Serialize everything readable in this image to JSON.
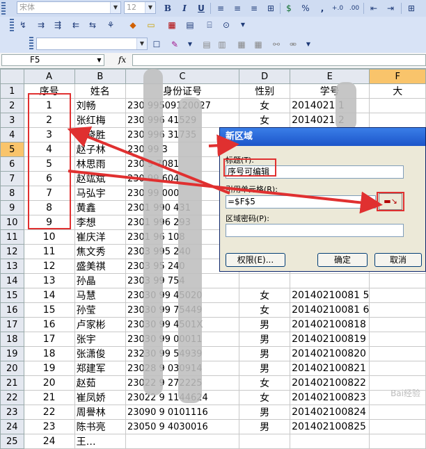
{
  "toolbar": {
    "font_name": "宋体",
    "font_size": "12",
    "bold": "B",
    "italic": "I",
    "underline": "U",
    "percent": "%",
    "comma": ","
  },
  "formula_bar": {
    "cell_ref": "F5",
    "fx": "fx"
  },
  "columns": [
    "A",
    "B",
    "C",
    "D",
    "E",
    "F"
  ],
  "headers": {
    "seq": "序号",
    "name": "姓名",
    "id": "身份证号",
    "gender": "性别",
    "student_id": "学号",
    "class": "大"
  },
  "rows": [
    {
      "n": "2",
      "seq": "1",
      "name": "刘畅",
      "id": "230  99509120027",
      "gender": "女",
      "sid": "2014021    1"
    },
    {
      "n": "3",
      "seq": "2",
      "name": "张红梅",
      "id": "230  996   41529",
      "gender": "女",
      "sid": "2014021    2"
    },
    {
      "n": "4",
      "seq": "3",
      "name": "刘晓胜",
      "id": "230  996   31735",
      "gender": "男",
      "sid": "2014021    3"
    },
    {
      "n": "5",
      "seq": "4",
      "name": "赵子林",
      "id": "230  99    3",
      "gender": "男",
      "sid": ""
    },
    {
      "n": "6",
      "seq": "5",
      "name": "林思雨",
      "id": "230  9    7081",
      "gender": "",
      "sid": ""
    },
    {
      "n": "7",
      "seq": "6",
      "name": "赵竑斌",
      "id": "230  99    604",
      "gender": "",
      "sid": ""
    },
    {
      "n": "8",
      "seq": "7",
      "name": "马弘宇",
      "id": "230  99    000",
      "gender": "",
      "sid": ""
    },
    {
      "n": "9",
      "seq": "8",
      "name": "黄鑫",
      "id": "2301  990  431",
      "gender": "",
      "sid": ""
    },
    {
      "n": "10",
      "seq": "9",
      "name": "李想",
      "id": "2301  996  293",
      "gender": "",
      "sid": ""
    },
    {
      "n": "11",
      "seq": "10",
      "name": "崔庆洋",
      "id": "2301  96   108",
      "gender": "",
      "sid": ""
    },
    {
      "n": "12",
      "seq": "11",
      "name": "焦文秀",
      "id": "2303  995  240",
      "gender": "",
      "sid": ""
    },
    {
      "n": "13",
      "seq": "12",
      "name": "盛美祺",
      "id": "2303  95   240",
      "gender": "",
      "sid": ""
    },
    {
      "n": "14",
      "seq": "13",
      "name": "孙晶",
      "id": "2303  99   754",
      "gender": "",
      "sid": ""
    },
    {
      "n": "15",
      "seq": "14",
      "name": "马慧",
      "id": "23030  99  45020",
      "gender": "女",
      "sid": "20140210081 5"
    },
    {
      "n": "16",
      "seq": "15",
      "name": "孙莹",
      "id": "23030  99  75449",
      "gender": "女",
      "sid": "20140210081 6"
    },
    {
      "n": "17",
      "seq": "16",
      "name": "卢家彬",
      "id": "23030  99  4501X",
      "gender": "男",
      "sid": "201402100818"
    },
    {
      "n": "18",
      "seq": "17",
      "name": "张宇",
      "id": "23030  99  00011",
      "gender": "男",
      "sid": "201402100819"
    },
    {
      "n": "19",
      "seq": "18",
      "name": "张潇俊",
      "id": "23230  99  54939",
      "gender": "男",
      "sid": "201402100820"
    },
    {
      "n": "20",
      "seq": "19",
      "name": "郑建军",
      "id": "23028  9   030914",
      "gender": "男",
      "sid": "201402100821"
    },
    {
      "n": "21",
      "seq": "20",
      "name": "赵茹",
      "id": "23022  9   272225",
      "gender": "女",
      "sid": "201402100822"
    },
    {
      "n": "22",
      "seq": "21",
      "name": "崔凤娇",
      "id": "23022  9   1144624",
      "gender": "女",
      "sid": "201402100823"
    },
    {
      "n": "23",
      "seq": "22",
      "name": "周譽林",
      "id": "23090  9   0101116",
      "gender": "男",
      "sid": "201402100824"
    },
    {
      "n": "24",
      "seq": "23",
      "name": "陈书亮",
      "id": "23050  9   4030016",
      "gender": "男",
      "sid": "201402100825"
    },
    {
      "n": "25",
      "seq": "24",
      "name": "王…",
      "id": "",
      "gender": "",
      "sid": ""
    }
  ],
  "dialog": {
    "title": "新区域",
    "title_label": "标题(T):",
    "title_value": "序号可编辑",
    "ref_label": "引用单元格(R):",
    "ref_value": "=$F$5",
    "pwd_label": "区域密码(P):",
    "pwd_value": "",
    "perm_button": "权限(E)...",
    "ok_button": "确定",
    "cancel_button": "取消"
  },
  "watermark": "Bai经验"
}
